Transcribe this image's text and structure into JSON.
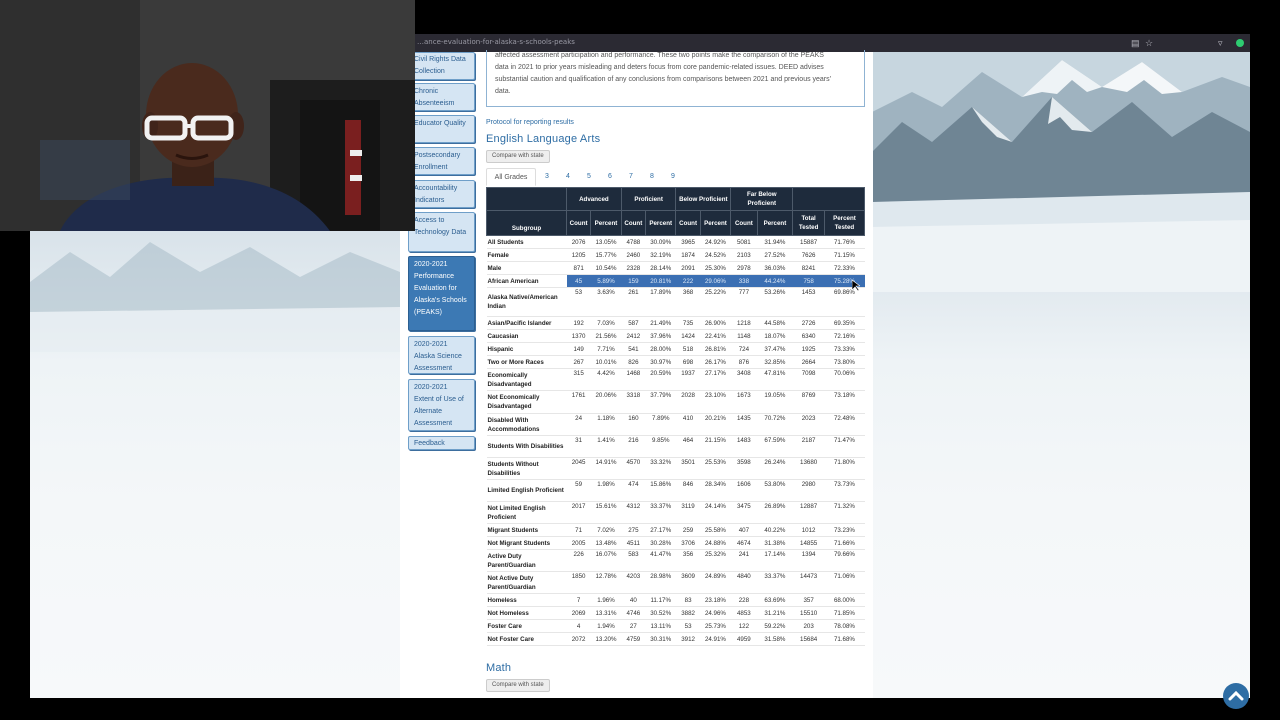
{
  "browser": {
    "url": "…ance-evaluation-for-alaska-s-schools-peaks"
  },
  "sidebar": {
    "items": [
      {
        "label": "Civil Rights Data Collection"
      },
      {
        "label": "Chronic Absenteeism"
      },
      {
        "label": "Educator Quality"
      },
      {
        "label": "Postsecondary Enrollment"
      },
      {
        "label": "Accountability Indicators"
      },
      {
        "label": "Access to Technology Data"
      },
      {
        "label": "2020-2021 Performance Evaluation for Alaska's Schools (PEAKS)",
        "active": true
      },
      {
        "label": "2020-2021 Alaska Science Assessment"
      },
      {
        "label": "2020-2021 Extent of Use of Alternate Assessment"
      },
      {
        "label": "Feedback"
      }
    ]
  },
  "notice": {
    "lines": [
      "affected assessment participation and performance. These two points make the comparison of the PEAKS",
      "data in 2021 to prior years misleading and deters focus from core pandemic-related issues. DEED advises",
      "substantial caution and qualification of any conclusions from comparisons between 2021 and previous years'",
      "data."
    ]
  },
  "protocol_link": "Protocol for reporting results",
  "ela": {
    "heading": "English Language Arts",
    "compare_button": "Compare with state",
    "tabs": [
      "All Grades",
      "3",
      "4",
      "5",
      "6",
      "7",
      "8",
      "9"
    ],
    "header_groups": [
      "Advanced",
      "Proficient",
      "Below Proficient",
      "Far Below Proficient"
    ],
    "columns": [
      "Subgroup",
      "Count",
      "Percent",
      "Count",
      "Percent",
      "Count",
      "Percent",
      "Count",
      "Percent",
      "Total Tested",
      "Percent Tested"
    ],
    "rows": [
      [
        "All Students",
        "2076",
        "13.05%",
        "4788",
        "30.09%",
        "3965",
        "24.92%",
        "5081",
        "31.94%",
        "15887",
        "71.76%"
      ],
      [
        "Female",
        "1205",
        "15.77%",
        "2460",
        "32.19%",
        "1874",
        "24.52%",
        "2103",
        "27.52%",
        "7626",
        "71.15%"
      ],
      [
        "Male",
        "871",
        "10.54%",
        "2328",
        "28.14%",
        "2091",
        "25.30%",
        "2978",
        "36.03%",
        "8241",
        "72.33%"
      ],
      [
        "African American",
        "45",
        "5.89%",
        "159",
        "20.81%",
        "222",
        "29.06%",
        "338",
        "44.24%",
        "758",
        "75.28%"
      ],
      [
        "Alaska Native/American Indian",
        "53",
        "3.63%",
        "261",
        "17.89%",
        "368",
        "25.22%",
        "777",
        "53.26%",
        "1453",
        "69.86%"
      ],
      [
        "Asian/Pacific Islander",
        "192",
        "7.03%",
        "587",
        "21.49%",
        "735",
        "26.90%",
        "1218",
        "44.58%",
        "2726",
        "69.35%"
      ],
      [
        "Caucasian",
        "1370",
        "21.56%",
        "2412",
        "37.96%",
        "1424",
        "22.41%",
        "1148",
        "18.07%",
        "6340",
        "72.16%"
      ],
      [
        "Hispanic",
        "149",
        "7.71%",
        "541",
        "28.00%",
        "518",
        "26.81%",
        "724",
        "37.47%",
        "1925",
        "73.33%"
      ],
      [
        "Two or More Races",
        "267",
        "10.01%",
        "826",
        "30.97%",
        "698",
        "26.17%",
        "876",
        "32.85%",
        "2664",
        "73.80%"
      ],
      [
        "Economically Disadvantaged",
        "315",
        "4.42%",
        "1468",
        "20.59%",
        "1937",
        "27.17%",
        "3408",
        "47.81%",
        "7098",
        "70.06%"
      ],
      [
        "Not Economically Disadvantaged",
        "1761",
        "20.06%",
        "3318",
        "37.79%",
        "2028",
        "23.10%",
        "1673",
        "19.05%",
        "8769",
        "73.18%"
      ],
      [
        "Disabled With Accommodations",
        "24",
        "1.18%",
        "160",
        "7.89%",
        "410",
        "20.21%",
        "1435",
        "70.72%",
        "2023",
        "72.48%"
      ],
      [
        "Students With Disabilities",
        "31",
        "1.41%",
        "216",
        "9.85%",
        "464",
        "21.15%",
        "1483",
        "67.59%",
        "2187",
        "71.47%"
      ],
      [
        "Students Without Disabilities",
        "2045",
        "14.91%",
        "4570",
        "33.32%",
        "3501",
        "25.53%",
        "3598",
        "26.24%",
        "13680",
        "71.80%"
      ],
      [
        "Limited English Proficient",
        "59",
        "1.98%",
        "474",
        "15.86%",
        "846",
        "28.34%",
        "1606",
        "53.80%",
        "2980",
        "73.73%"
      ],
      [
        "Not Limited English Proficient",
        "2017",
        "15.61%",
        "4312",
        "33.37%",
        "3119",
        "24.14%",
        "3475",
        "26.89%",
        "12887",
        "71.32%"
      ],
      [
        "Migrant Students",
        "71",
        "7.02%",
        "275",
        "27.17%",
        "259",
        "25.58%",
        "407",
        "40.22%",
        "1012",
        "73.23%"
      ],
      [
        "Not Migrant Students",
        "2005",
        "13.48%",
        "4511",
        "30.28%",
        "3706",
        "24.88%",
        "4674",
        "31.38%",
        "14855",
        "71.66%"
      ],
      [
        "Active Duty Parent/Guardian",
        "226",
        "16.07%",
        "583",
        "41.47%",
        "356",
        "25.32%",
        "241",
        "17.14%",
        "1394",
        "79.66%"
      ],
      [
        "Not Active Duty Parent/Guardian",
        "1850",
        "12.78%",
        "4203",
        "28.98%",
        "3609",
        "24.89%",
        "4840",
        "33.37%",
        "14473",
        "71.06%"
      ],
      [
        "Homeless",
        "7",
        "1.96%",
        "40",
        "11.17%",
        "83",
        "23.18%",
        "228",
        "63.69%",
        "357",
        "68.00%"
      ],
      [
        "Not Homeless",
        "2069",
        "13.31%",
        "4746",
        "30.52%",
        "3882",
        "24.96%",
        "4853",
        "31.21%",
        "15510",
        "71.85%"
      ],
      [
        "Foster Care",
        "4",
        "1.94%",
        "27",
        "13.11%",
        "53",
        "25.73%",
        "122",
        "59.22%",
        "203",
        "78.08%"
      ],
      [
        "Not Foster Care",
        "2072",
        "13.20%",
        "4759",
        "30.31%",
        "3912",
        "24.91%",
        "4959",
        "31.58%",
        "15684",
        "71.68%"
      ]
    ],
    "selected_row": 3
  },
  "math": {
    "heading": "Math",
    "compare_button": "Compare with state"
  },
  "colors": {
    "link": "#2e6da4",
    "table_header": "#1e2b3c",
    "selection": "#3b6fb3",
    "sidebar_active": "#3c79b4"
  }
}
